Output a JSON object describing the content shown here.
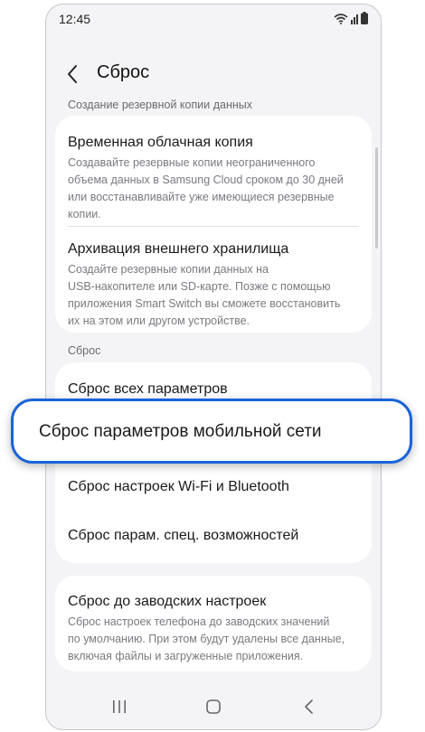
{
  "status": {
    "time": "12:45"
  },
  "header": {
    "title": "Сброс"
  },
  "backup": {
    "section_label": "Создание резервной копии данных",
    "items": [
      {
        "title": "Временная облачная копия",
        "desc": [
          "Создавайте резервные копии неограниченного",
          "объема данных в Samsung Cloud сроком до 30 дней",
          "или восстанавливайте уже имеющиеся резервные",
          "копии."
        ]
      },
      {
        "title": "Архивация внешнего хранилища",
        "desc": [
          "Создайте резервные копии данных на",
          "USB-накопителе или SD-карте. Позже с помощью",
          "приложения Smart Switch вы сможете восстановить",
          "их на этом или другом устройстве."
        ]
      }
    ]
  },
  "reset": {
    "section_label": "Сброс",
    "items": [
      {
        "title": "Сброс всех параметров"
      },
      {
        "title": "Сброс параметров мобильной сети"
      },
      {
        "title": "Сброс настроек Wi-Fi и Bluetooth"
      },
      {
        "title": "Сброс парам. спец. возможностей"
      }
    ]
  },
  "factory": {
    "title": "Сброс до заводских настроек",
    "desc": [
      "Сброс настроек телефона до заводских значений",
      "по умолчанию. При этом будут удалены все данные,",
      "включая файлы и загруженные приложения."
    ]
  },
  "colors": {
    "highlight_border": "#1a63d8",
    "background": "#f4f4f6"
  },
  "icons": {
    "back": "chevron-left-icon",
    "wifi": "wifi-icon",
    "battery": "battery-icon",
    "recents": "recents-icon",
    "home": "home-icon",
    "nav_back": "nav-back-icon"
  }
}
